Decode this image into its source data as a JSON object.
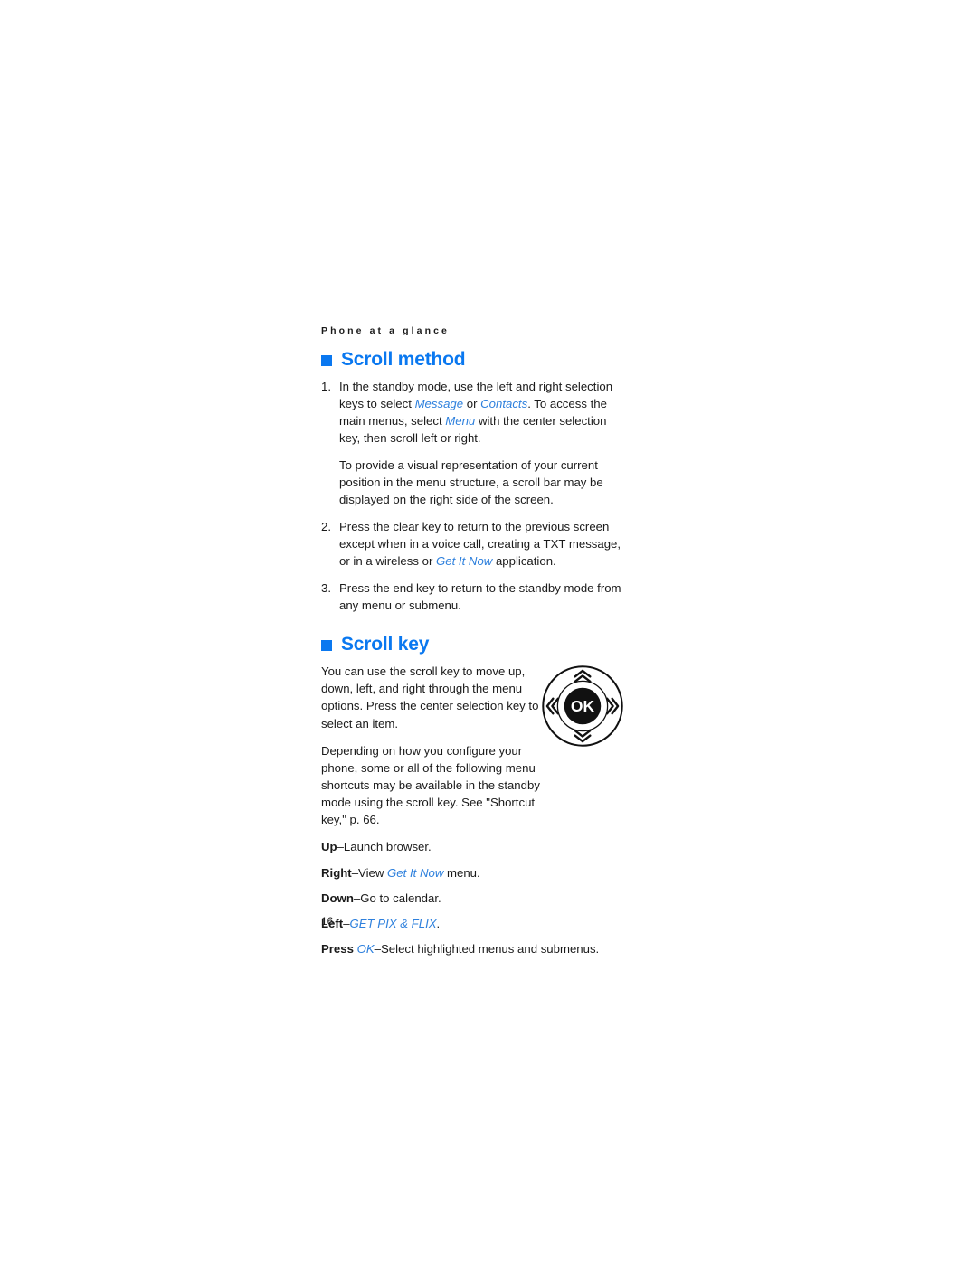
{
  "page": {
    "running_head": "Phone at a glance",
    "folio": "16",
    "accent_color": "#0A78F0",
    "link_color": "#2E80DD",
    "text_color": "#1a1a1a",
    "background": "#ffffff"
  },
  "sections": [
    {
      "heading": "Scroll method",
      "bullet_icon": "filled-square-bullet-icon",
      "numbered_steps": [
        {
          "number": "1.",
          "parts": [
            {
              "text": "In the standby mode, use the left and right selection keys to select ",
              "style": "normal"
            },
            {
              "text": "Message",
              "style": "link"
            },
            {
              "text": " or ",
              "style": "normal"
            },
            {
              "text": "Contacts",
              "style": "link"
            },
            {
              "text": ". To access the main menus, select ",
              "style": "normal"
            },
            {
              "text": "Menu",
              "style": "link"
            },
            {
              "text": " with the center selection key, then scroll left or right.",
              "style": "normal"
            }
          ]
        },
        {
          "number": "2.",
          "parts": [
            {
              "text": "Press the clear key to return to the previous screen except when in a voice call, creating a TXT message, or in a wireless or ",
              "style": "normal"
            },
            {
              "text": "Get It Now",
              "style": "link"
            },
            {
              "text": " application.",
              "style": "normal"
            }
          ]
        },
        {
          "number": "3.",
          "parts": [
            {
              "text": "Press the end key to return to the standby mode from any menu or submenu.",
              "style": "normal"
            }
          ]
        }
      ],
      "inset_paragraph": "To provide a visual representation of your current position in the menu structure, a scroll bar may be displayed on the right side of the screen."
    },
    {
      "heading": "Scroll key",
      "bullet_icon": "filled-square-bullet-icon",
      "paragraphs": [
        "You can use the scroll key to move up, down, left, and right through the menu options. Press the center selection key to select an item.",
        "Depending on how you configure your phone, some or all of the following menu shortcuts may be available in the standby mode using the scroll key. See \"Shortcut key,\" p. 66."
      ],
      "graphic": {
        "name": "scroll-key-diagram",
        "center_label": "OK",
        "directions": [
          "up",
          "right",
          "down",
          "left"
        ]
      },
      "shortcuts": [
        {
          "parts": [
            {
              "text": "Up",
              "style": "bold"
            },
            {
              "text": "–Launch browser.",
              "style": "normal"
            }
          ]
        },
        {
          "parts": [
            {
              "text": "Right",
              "style": "bold"
            },
            {
              "text": "–View ",
              "style": "normal"
            },
            {
              "text": "Get It Now",
              "style": "link"
            },
            {
              "text": " menu.",
              "style": "normal"
            }
          ]
        },
        {
          "parts": [
            {
              "text": "Down",
              "style": "bold"
            },
            {
              "text": "–Go to calendar.",
              "style": "normal"
            }
          ]
        },
        {
          "parts": [
            {
              "text": "Left",
              "style": "bold"
            },
            {
              "text": "–",
              "style": "normal"
            },
            {
              "text": "GET PIX & FLIX",
              "style": "link"
            },
            {
              "text": ".",
              "style": "normal"
            }
          ]
        },
        {
          "parts": [
            {
              "text": "Press ",
              "style": "bold"
            },
            {
              "text": "OK",
              "style": "link"
            },
            {
              "text": "–Select highlighted menus and submenus.",
              "style": "normal"
            }
          ]
        }
      ]
    }
  ]
}
